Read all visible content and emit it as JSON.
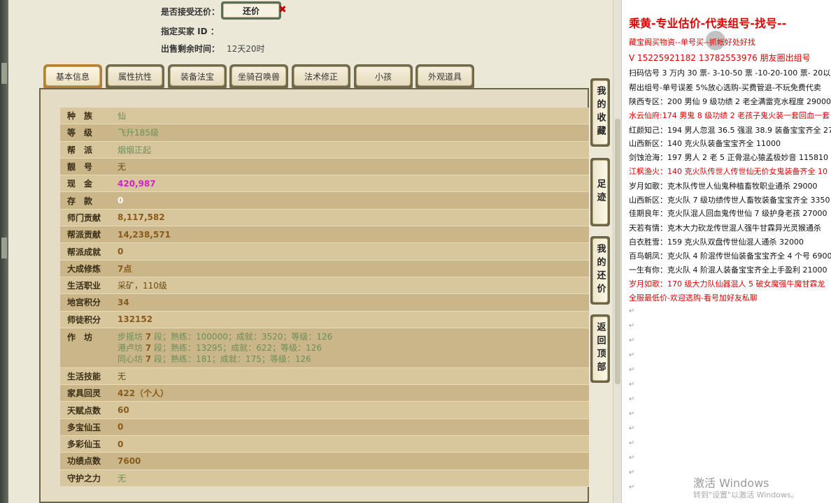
{
  "header": {
    "accept_offer_label": "是否接受还价：",
    "offer_button_label": "还价",
    "close_mark": "✖",
    "buyer_id_label": "指定买家 ID ：",
    "time_left_label": "出售剩余时间：",
    "time_left_value": "12天20时"
  },
  "tabs": [
    {
      "label": "基本信息"
    },
    {
      "label": "属性抗性"
    },
    {
      "label": "装备法宝"
    },
    {
      "label": "坐骑召唤兽"
    },
    {
      "label": "法术修正"
    },
    {
      "label": "小孩"
    },
    {
      "label": "外观道具"
    }
  ],
  "rows": [
    {
      "label": "种　族",
      "value": "仙"
    },
    {
      "label": "等　级",
      "value": "飞升185级"
    },
    {
      "label": "帮　派",
      "value": "烟烟正起"
    },
    {
      "label": "靓　号",
      "value": "无"
    },
    {
      "label": "现　金",
      "value": "420,987"
    },
    {
      "label": "存　款",
      "value": "0"
    },
    {
      "label": "师门贡献",
      "value": "8,117,582"
    },
    {
      "label": "帮派贡献",
      "value": "14,238,571"
    },
    {
      "label": "帮派成就",
      "value": "0"
    },
    {
      "label": "大成修炼",
      "value": "7点"
    },
    {
      "label": "生活职业",
      "value": "采矿，110级"
    },
    {
      "label": "地宫积分",
      "value": "34"
    },
    {
      "label": "师徒积分",
      "value": "132152"
    },
    {
      "label": "作　坊",
      "lines": [
        {
          "pre": "步摇坊",
          "lvl": "7",
          "rest": "段；熟练：100000；成就：3520；等级：126"
        },
        {
          "pre": "港卢坊",
          "lvl": "7",
          "rest": "段；熟练：13295；成就：622；等级：126"
        },
        {
          "pre": "同心坊",
          "lvl": "7",
          "rest": "段；熟练：181；成就：175；等级：126"
        }
      ]
    },
    {
      "label": "生活技能",
      "value": "无"
    },
    {
      "label": "家具回灵",
      "value": "422（个人）"
    },
    {
      "label": "天赋点数",
      "value": "60"
    },
    {
      "label": "多宝仙玉",
      "value": "0"
    },
    {
      "label": "多彩仙玉",
      "value": "0"
    },
    {
      "label": "功绩点数",
      "value": "7600"
    },
    {
      "label": "守护之力",
      "value": "无"
    }
  ],
  "side_buttons": [
    {
      "label": "我的收藏"
    },
    {
      "label": "足迹"
    },
    {
      "label": "我的还价"
    },
    {
      "label": "返回顶部"
    }
  ],
  "doc": {
    "title": "乘黄-专业估价-代卖组号-找号--",
    "lines": [
      {
        "text": "藏宝阁买物资--单号买--抓帐好处好找",
        "red": true
      },
      {
        "text": "V 15225921182   13782553976 朋友圈出组号",
        "red": true,
        "v": true
      },
      {
        "text": "扫码估号 3 万内 30 票- 3-10-50 票  -10-20-100 票- 20以上",
        "red": false
      },
      {
        "text": "帮出组号-单号误差 5%放心选购-买费管退-不玩免费代卖",
        "red": false
      },
      {
        "text": "陕西专区：200 男仙 9 级功绩 2 老全满雷克水程度 29000",
        "red": false
      },
      {
        "text": "水云仙府:174 男鬼 8 级功绩 2 老孩子鬼火装一套回血一套",
        "red": true
      },
      {
        "text": "红颜知己：194 男人忽混 36.5 强混 38.9 装备宝宝齐全 270",
        "red": false
      },
      {
        "text": "山西新区：140 克火队装备宝宝齐全 11000",
        "red": false
      },
      {
        "text": "剑蚀沧海：197 男人 2 老 5 正骨混心猿孟极妙音 115810",
        "red": false
      },
      {
        "text": "江枫渔火：140 克火队传世人传世仙无价女鬼装备齐全 10",
        "red": true
      },
      {
        "text": "岁月如歌：克木队传世人仙鬼种植畜牧职业通杀 29000",
        "red": false
      },
      {
        "text": "山西新区：克火队 7 级功绩传世人畜牧装备宝宝齐全 3350",
        "red": false
      },
      {
        "text": "佳期良年：克火队混人回血鬼传世仙 7 级护身老孩 27000",
        "red": false
      },
      {
        "text": "天若有情：克木大力砍龙传世混人强牛甘霖异光灵猴通杀",
        "red": false
      },
      {
        "text": "白衣胜雪：159 克火队双盘传世仙混人通杀 32000",
        "red": false
      },
      {
        "text": "百鸟朝凤：克火队 4 阶混传世仙装备宝宝齐全 4 个号 6900",
        "red": false
      },
      {
        "text": "一生有你：克火队 4 阶混人装备宝宝齐全上手盈利 21000",
        "red": false
      },
      {
        "text": "岁月如歌：170 级大力队仙器混人 5 破女魔强牛魔甘霖龙",
        "red": true
      },
      {
        "text": "全服最低价-欢迎选购-看号加好友私聊",
        "red": true
      }
    ],
    "empty_mark": "↵",
    "watermark": "激活 Windows",
    "watermark_sub": "转到\"设置\"以激活 Windows。"
  }
}
